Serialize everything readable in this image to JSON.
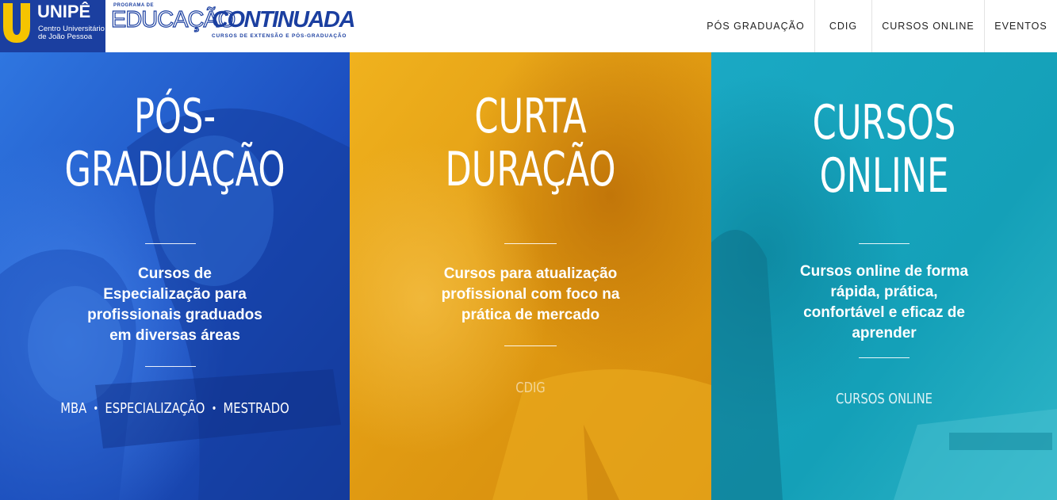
{
  "header": {
    "logo": {
      "name": "UNIPÊ",
      "subtitle_line1": "Centro Universitário",
      "subtitle_line2": "de João Pessoa"
    },
    "program_logo": {
      "small_line1": "PROGRAMA DE",
      "word1": "EDUCAÇÃO",
      "word2": "CONTINUADA",
      "tagline": "CURSOS DE EXTENSÃO E PÓS-GRADUAÇÃO"
    },
    "nav": [
      {
        "label": "PÓS GRADUAÇÃO"
      },
      {
        "label": "CDIG"
      },
      {
        "label": "CURSOS ONLINE"
      },
      {
        "label": "EVENTOS"
      }
    ]
  },
  "panels": [
    {
      "title_lines": [
        "PÓS-",
        "GRADUAÇÃO"
      ],
      "description_lines": [
        "Cursos de",
        "Especialização para",
        "profissionais graduados",
        "em diversas áreas"
      ],
      "links": [
        "MBA",
        "ESPECIALIZAÇÃO",
        "MESTRADO"
      ],
      "bullet": "•"
    },
    {
      "title_lines": [
        "CURTA",
        "DURAÇÃO"
      ],
      "description_lines": [
        "Cursos para atualização",
        "profissional com foco na",
        "prática de mercado"
      ],
      "links": [
        "CDIG"
      ]
    },
    {
      "title_lines": [
        "CURSOS",
        "ONLINE"
      ],
      "description_lines": [
        "Cursos online de forma",
        "rápida, prática,",
        "confortável e eficaz de",
        "aprender"
      ],
      "links": [
        "CURSOS ONLINE"
      ]
    }
  ],
  "colors": {
    "brand_blue": "#1b3fa0",
    "panel_blue": "#1e58c8",
    "panel_orange": "#e29f16",
    "panel_teal": "#14a4bb"
  }
}
